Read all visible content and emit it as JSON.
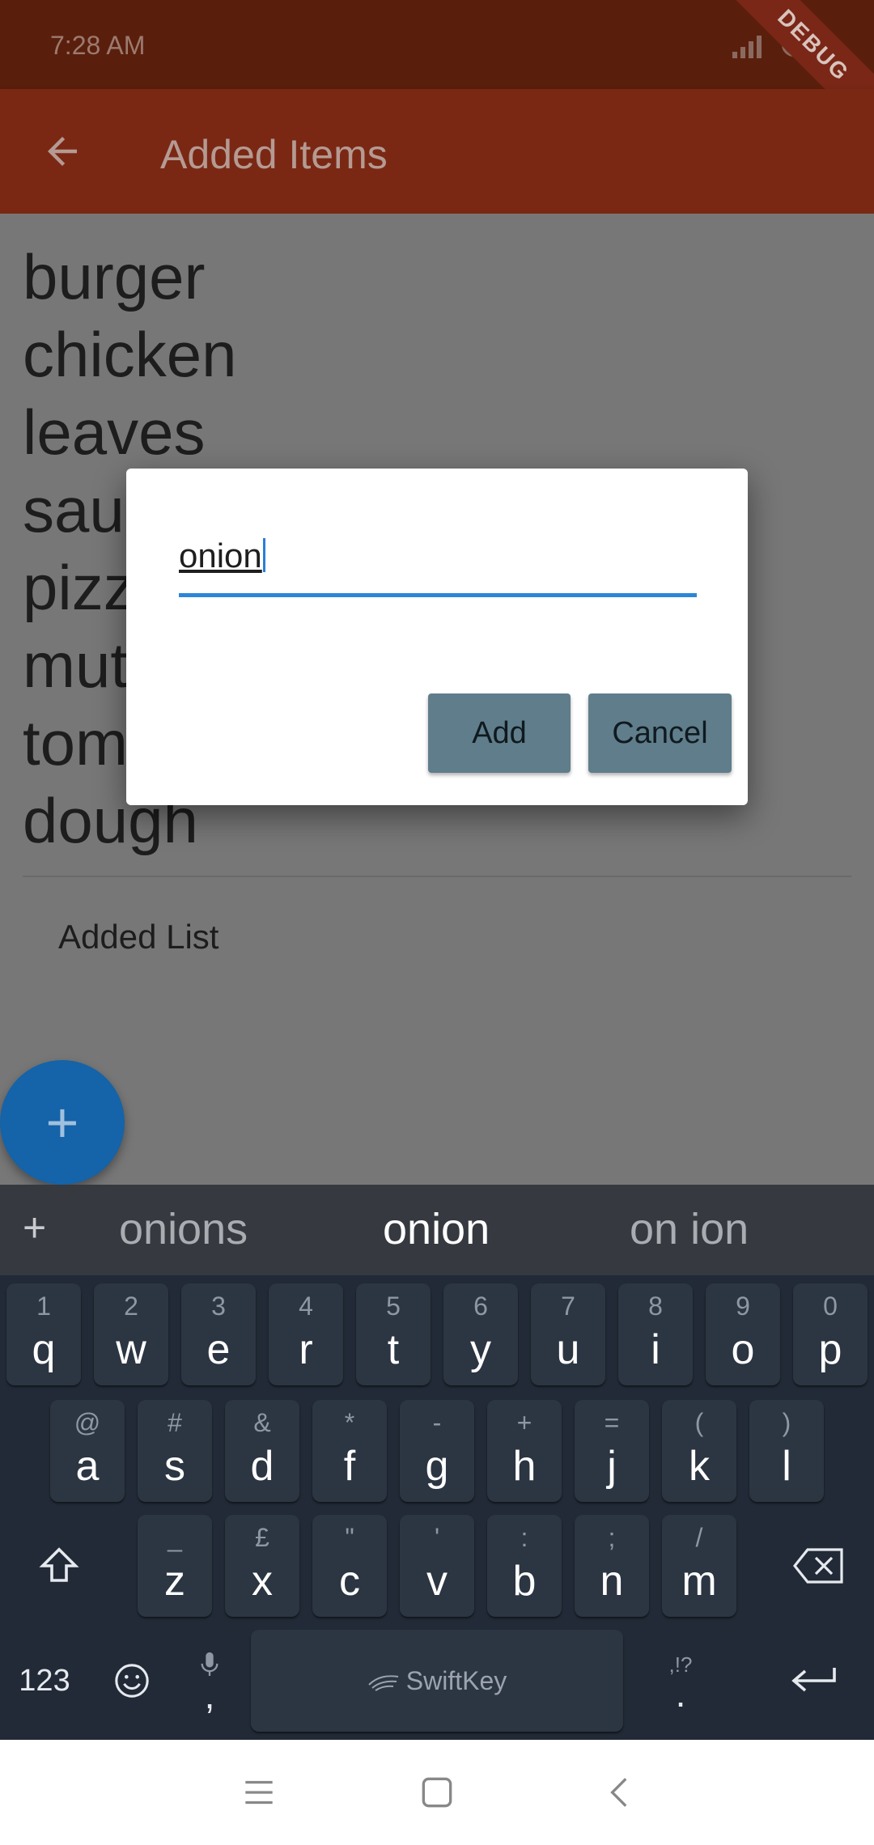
{
  "status_bar": {
    "time": "7:28 AM",
    "debug_banner": "DEBUG"
  },
  "app_bar": {
    "title": "Added Items",
    "back_icon": "arrow-back-icon"
  },
  "items": [
    "burger",
    "chicken",
    "leaves",
    "sau",
    "pizz",
    "mut",
    "tom",
    "dough"
  ],
  "footer_label": "Added List",
  "fab": {
    "label": "+"
  },
  "dialog": {
    "input_value": "onion",
    "add_label": "Add",
    "cancel_label": "Cancel"
  },
  "keyboard": {
    "suggestion_plus": "+",
    "suggestions": [
      "onions",
      "onion",
      "on ion"
    ],
    "row1": [
      [
        "1",
        "q"
      ],
      [
        "2",
        "w"
      ],
      [
        "3",
        "e"
      ],
      [
        "4",
        "r"
      ],
      [
        "5",
        "t"
      ],
      [
        "6",
        "y"
      ],
      [
        "7",
        "u"
      ],
      [
        "8",
        "i"
      ],
      [
        "9",
        "o"
      ],
      [
        "0",
        "p"
      ]
    ],
    "row2": [
      [
        "@",
        "a"
      ],
      [
        "#",
        "s"
      ],
      [
        "&",
        "d"
      ],
      [
        "*",
        "f"
      ],
      [
        "-",
        "g"
      ],
      [
        "+",
        "h"
      ],
      [
        "=",
        "j"
      ],
      [
        "(",
        "k"
      ],
      [
        ")",
        "l"
      ]
    ],
    "row3": [
      [
        "_",
        "z"
      ],
      [
        "£",
        "x"
      ],
      [
        "\"",
        "c"
      ],
      [
        "'",
        "v"
      ],
      [
        ":",
        "b"
      ],
      [
        ";",
        "n"
      ],
      [
        "/",
        "m"
      ]
    ],
    "num_label": "123",
    "comma": ",",
    "period": ".",
    "period_sub": ",!?",
    "space_label": "SwiftKey"
  },
  "colors": {
    "status_bar": "#5a1f0c",
    "app_bar": "#7a2814",
    "fab": "#1563a8",
    "dialog_button": "#607d8b",
    "accent_underline": "#2b86d9",
    "keyboard_bg": "#212a36"
  }
}
